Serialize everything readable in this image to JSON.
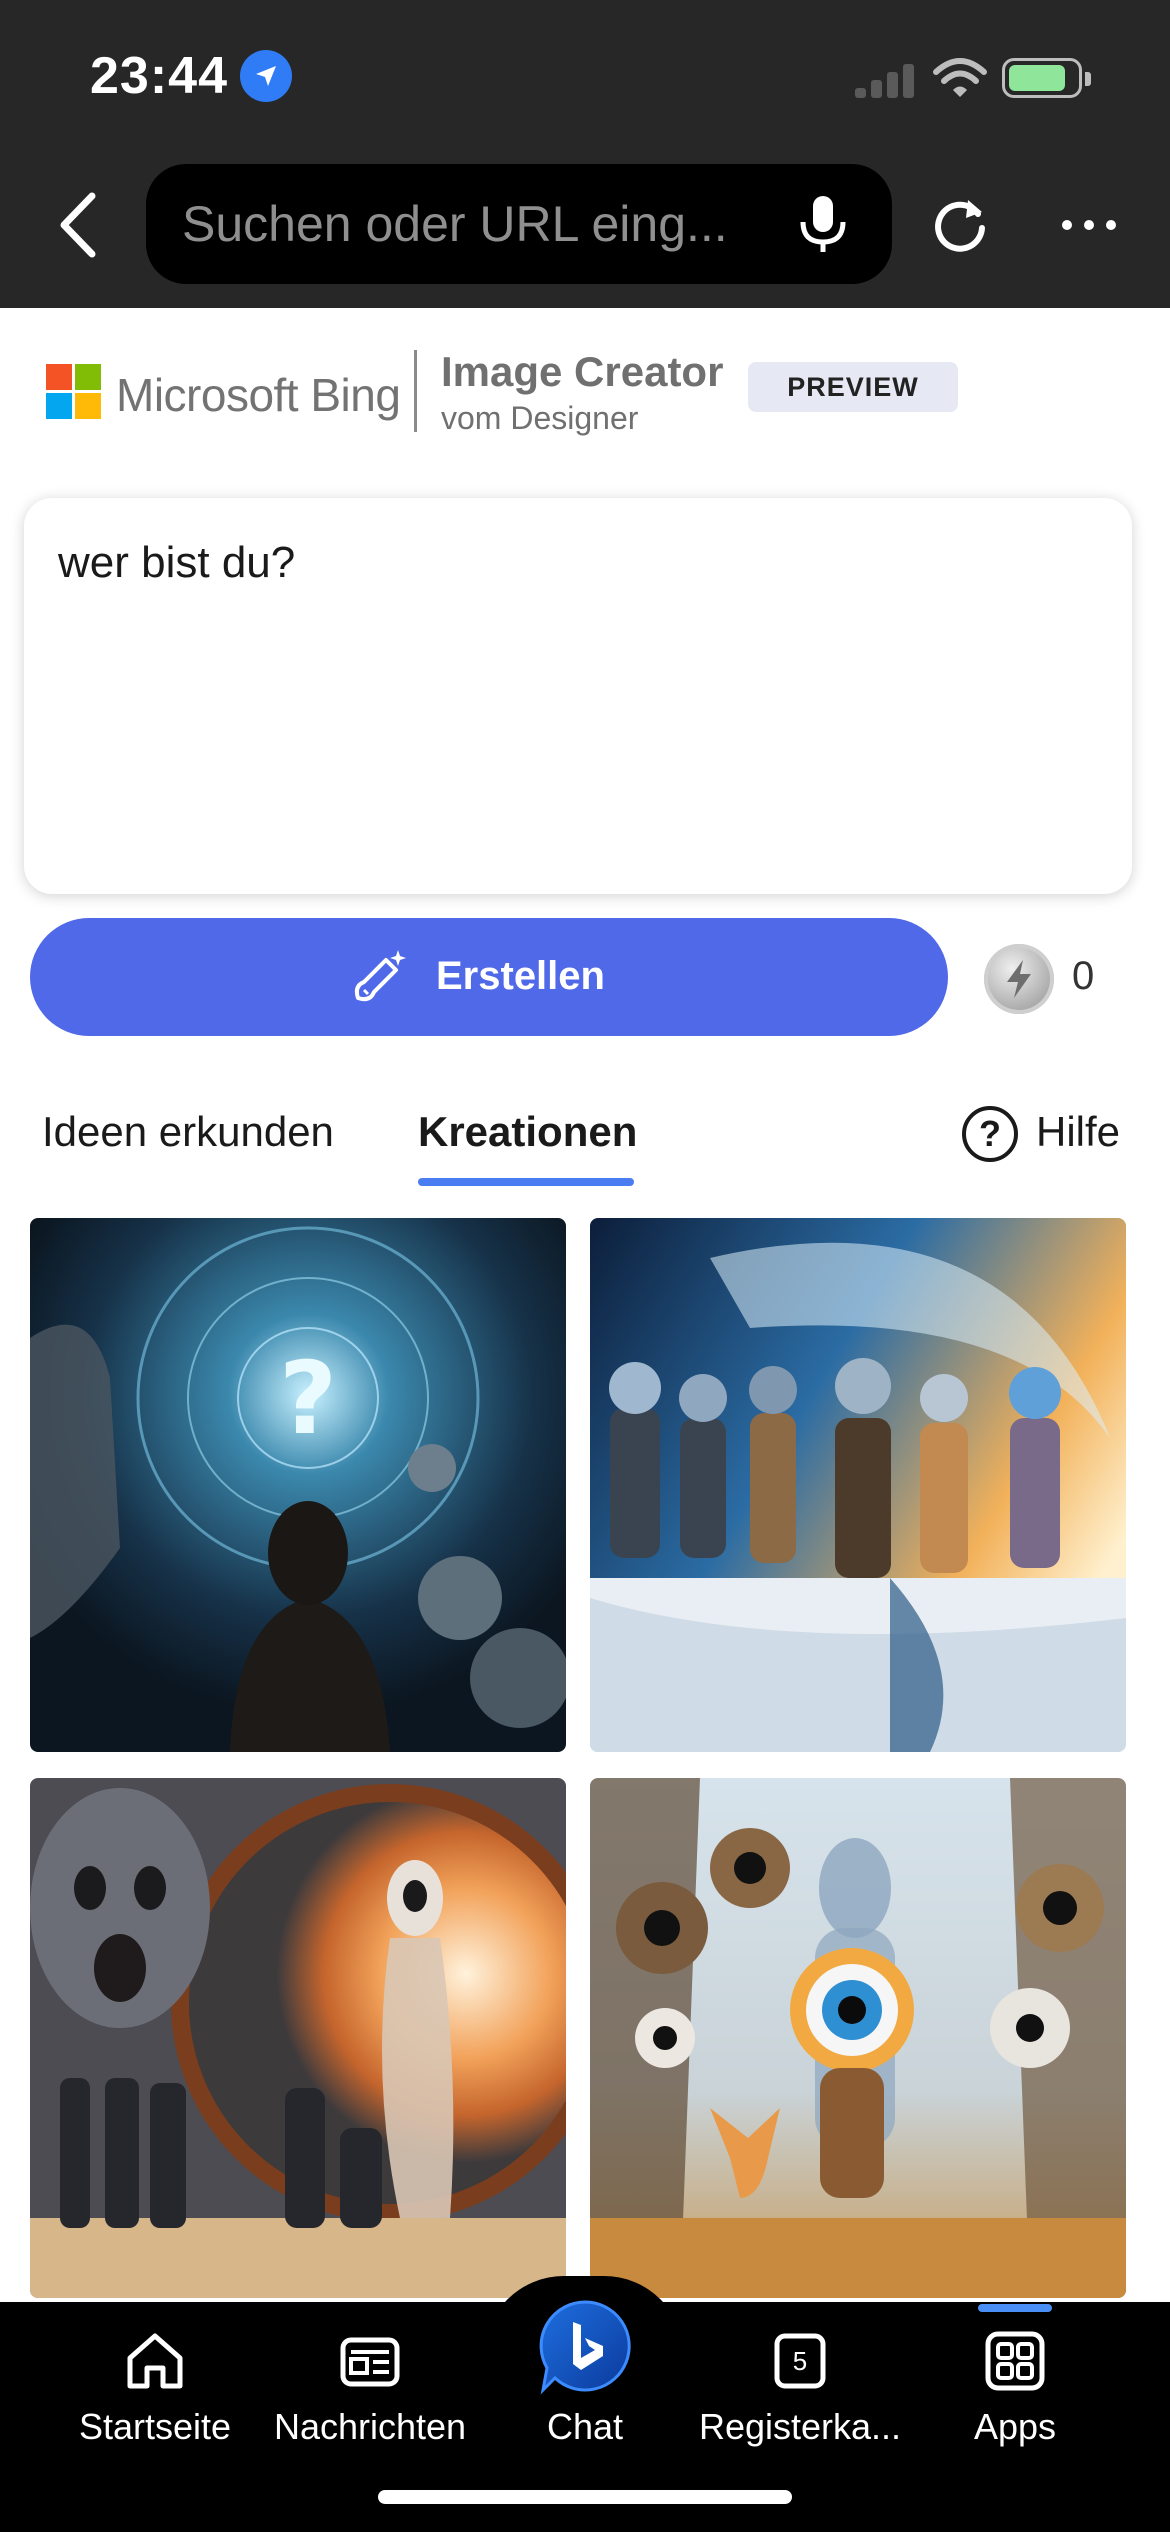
{
  "status_bar": {
    "time": "23:44"
  },
  "browser": {
    "url_placeholder": "Suchen oder URL eing..."
  },
  "brand": {
    "name": "Microsoft Bing",
    "product_title": "Image Creator",
    "product_subtitle": "vom Designer",
    "badge": "PREVIEW"
  },
  "prompt": {
    "value": "wer bist du?"
  },
  "actions": {
    "create_label": "Erstellen",
    "boost_count": "0"
  },
  "tabs": [
    {
      "label": "Ideen erkunden",
      "active": false
    },
    {
      "label": "Kreationen",
      "active": true
    }
  ],
  "help": {
    "label": "Hilfe"
  },
  "gallery": [
    {
      "icon": "image-question-man"
    },
    {
      "icon": "image-astronauts"
    },
    {
      "icon": "image-portal-alien"
    },
    {
      "icon": "image-eye-creature"
    }
  ],
  "bottom_nav": [
    {
      "label": "Startseite",
      "icon": "home-icon"
    },
    {
      "label": "Nachrichten",
      "icon": "news-icon"
    },
    {
      "label": "Chat",
      "icon": "bing-chat-icon"
    },
    {
      "label": "Registerka...",
      "icon": "tabs-icon",
      "count": "5"
    },
    {
      "label": "Apps",
      "icon": "apps-icon"
    }
  ],
  "colors": {
    "accent": "#5069e8",
    "tab_underline": "#4a7cf2",
    "chrome": "#272727"
  }
}
